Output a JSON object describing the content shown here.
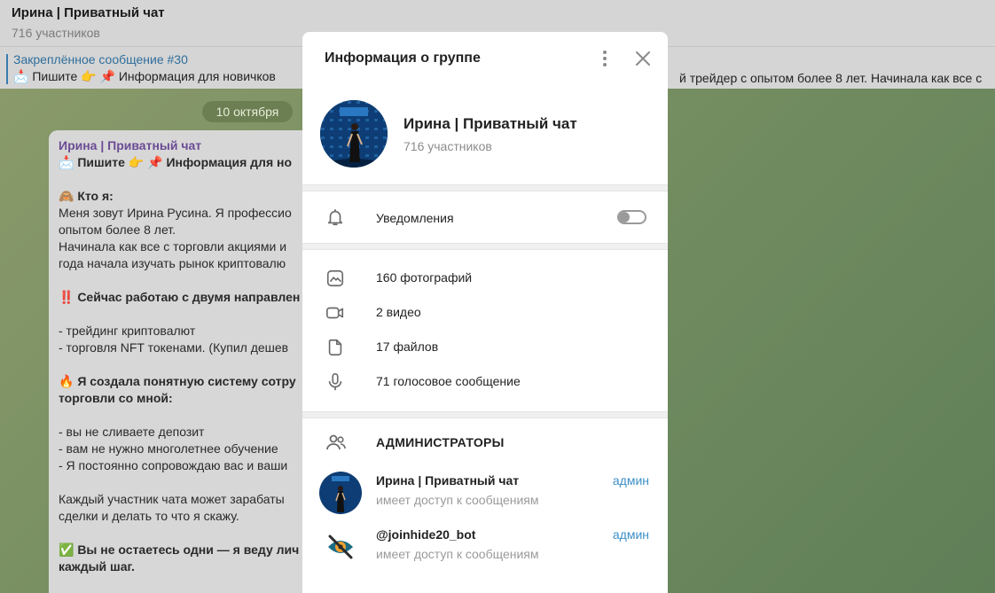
{
  "chat": {
    "title": "Ирина | Приватный чат",
    "members": "716 участников",
    "pinned_title": "Закреплённое сообщение #30",
    "pinned_text": "📩 Пишите 👉 📌 Информация для новичков",
    "pinned_text_right": "й трейдер с опытом более 8 лет.  Начинала как все с",
    "date": "10 октября",
    "message": {
      "author": "Ирина | Приватный чат",
      "lines": [
        "📩 Пишите 👉 📌 Информация для но",
        "",
        "🙈 Кто я:",
        "Меня зовут Ирина Русина. Я профессио",
        "опытом более 8 лет.",
        "Начинала как все с торговли акциями и",
        "года начала изучать рынок криптовалю",
        "",
        "‼️ Сейчас работаю с двумя направлен",
        "",
        "- трейдинг криптовалют",
        "- торговля NFT токенами. (Купил дешев",
        "",
        "🔥 Я создала понятную систему сотру",
        "торговли со мной:",
        "",
        "- вы не сливаете депозит",
        "- вам не нужно многолетнее обучение",
        "- Я постоянно сопровождаю вас и ваши",
        "",
        "Каждый участник чата может зарабаты",
        "сделки и делать то что я скажу.",
        "",
        "✅ Вы не остаетесь одни — я веду лич",
        "каждый шаг."
      ],
      "bold_lines": [
        0,
        2,
        8,
        13,
        14,
        23,
        24
      ]
    }
  },
  "modal": {
    "title": "Информация о группе",
    "group_name": "Ирина | Приватный чат",
    "group_members": "716 участников",
    "notifications_label": "Уведомления",
    "notifications_on": false,
    "media": [
      {
        "icon": "photo-icon",
        "label": "160 фотографий"
      },
      {
        "icon": "video-icon",
        "label": "2 видео"
      },
      {
        "icon": "file-icon",
        "label": "17 файлов"
      },
      {
        "icon": "microphone-icon",
        "label": "71 голосовое сообщение"
      }
    ],
    "admins_header": "АДМИНИСТРАТОРЫ",
    "admins": [
      {
        "name": "Ирина | Приватный чат",
        "status": "имеет доступ к сообщениям",
        "role": "админ"
      },
      {
        "name": "@joinhide20_bot",
        "status": "имеет доступ к сообщениям",
        "role": "админ"
      }
    ]
  },
  "colors": {
    "accent": "#3d8fc7",
    "author": "#6b4c95",
    "pinned_title": "#2f6e9c"
  }
}
